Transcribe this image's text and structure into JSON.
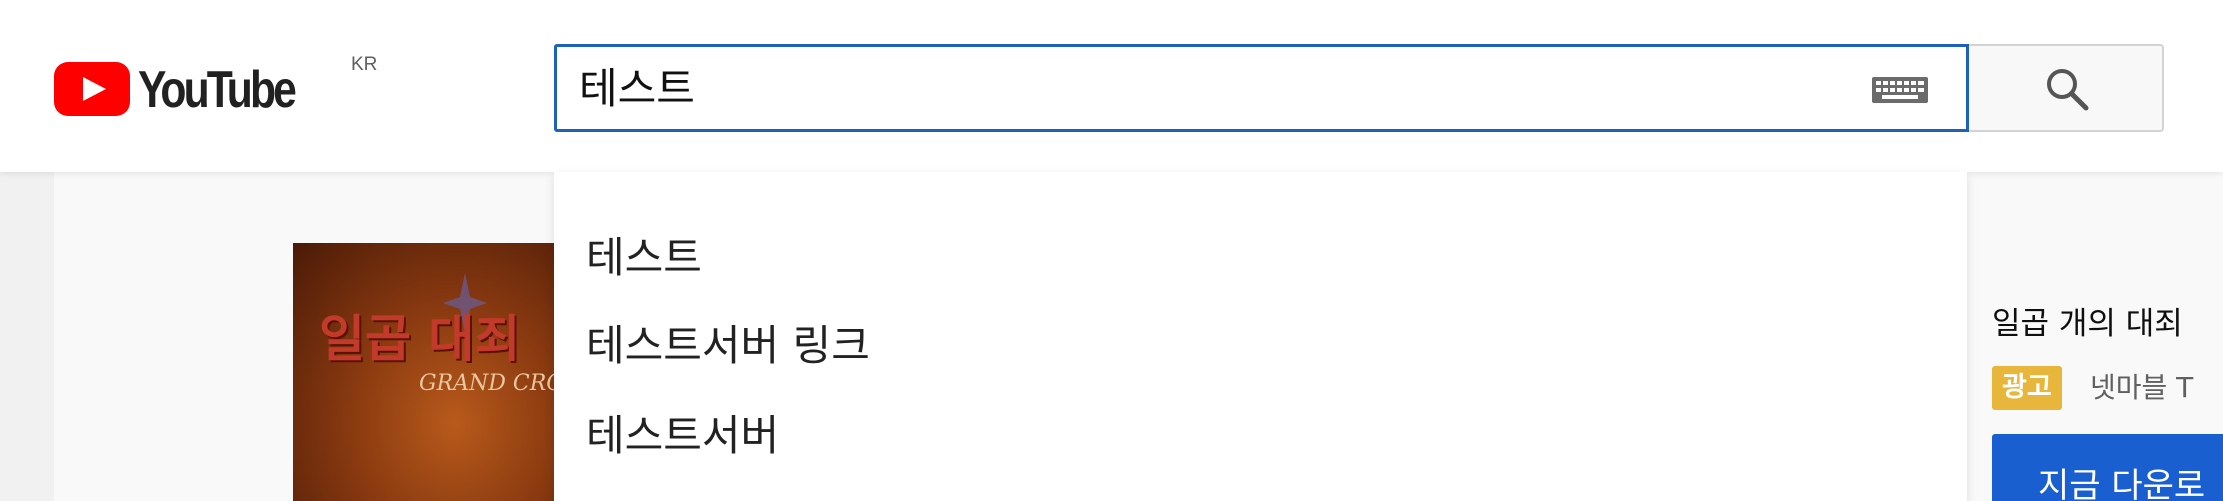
{
  "header": {
    "logo_text": "YouTube",
    "country_code": "KR",
    "search": {
      "value": "테스트"
    }
  },
  "suggestions": [
    "테스트",
    "테스트서버 링크",
    "테스트서버"
  ],
  "ad": {
    "thumbnail_title": "일곱 대죄",
    "thumbnail_subtitle": "GRAND CROSS",
    "title": "일곱 개의 대죄",
    "badge": "광고",
    "advertiser": "넷마블 T",
    "cta": "지금 다운로"
  },
  "colors": {
    "logo_red": "#ff0000",
    "search_focus_border": "#1c62b9",
    "ad_badge": "#e8b63a",
    "cta_blue": "#1a5fd0"
  },
  "icons": [
    "keyboard-icon",
    "search-icon",
    "play-icon"
  ]
}
